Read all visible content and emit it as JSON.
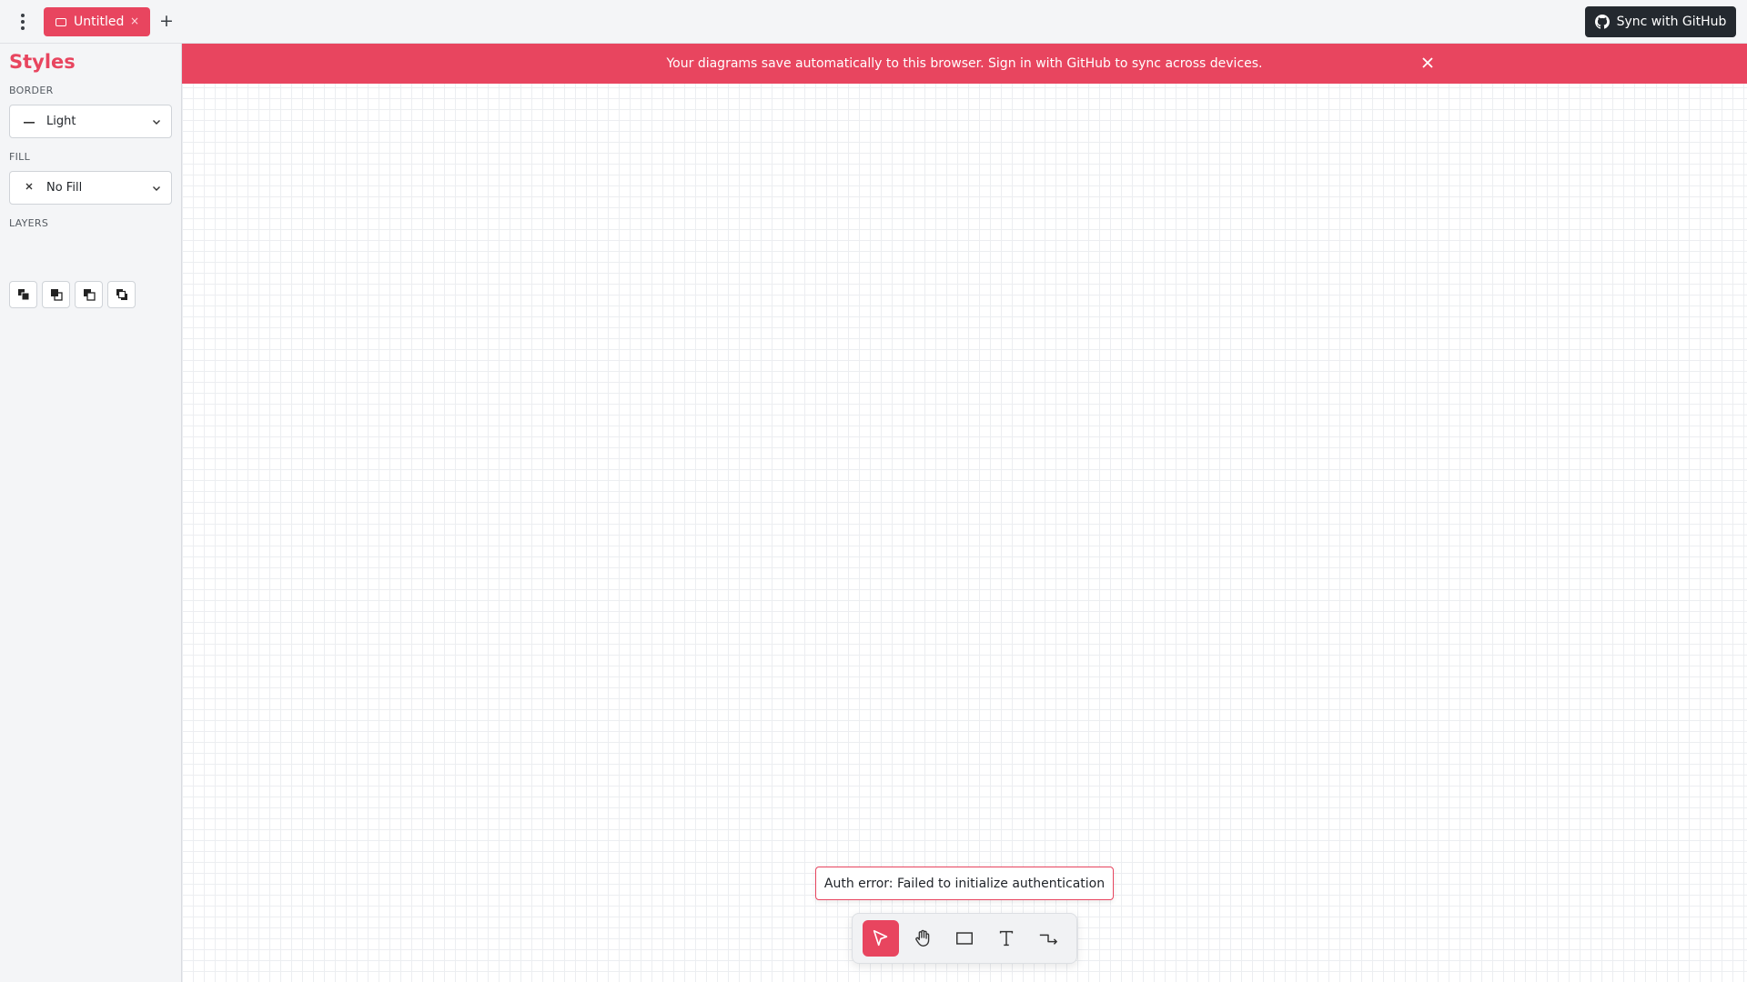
{
  "app": {
    "tabs": [
      {
        "label": "Untitled",
        "close": "×"
      }
    ],
    "new_tab": "+",
    "sync_button": "Sync with GitHub"
  },
  "sidebar": {
    "title": "Styles",
    "border": {
      "label": "BORDER",
      "value": "Light",
      "icon": "line-icon"
    },
    "fill": {
      "label": "FILL",
      "value": "No Fill",
      "icon": "x-icon"
    },
    "layers": {
      "label": "LAYERS",
      "buttons": [
        "bring-to-front-icon",
        "bring-forward-icon",
        "send-backward-icon",
        "send-to-back-icon"
      ]
    }
  },
  "banner": {
    "message": "Your diagrams save automatically to this browser. Sign in with GitHub to sync across devices."
  },
  "toast": {
    "message": "Auth error: Failed to initialize authentication"
  },
  "toolbar": {
    "tools": [
      "select",
      "pan",
      "rectangle",
      "text",
      "connector"
    ],
    "active_tool": "select"
  },
  "colors": {
    "accent": "#e8455f",
    "dark_button": "#24292f",
    "background": "#f4f5f7"
  }
}
